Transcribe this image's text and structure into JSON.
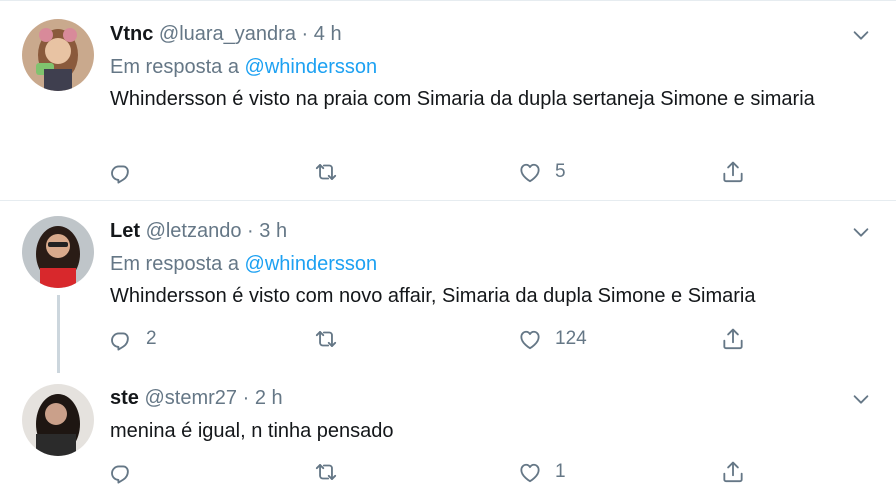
{
  "tweets": [
    {
      "display_name": "Vtnc",
      "handle": "@luara_yandra",
      "time": "4 h",
      "reply_prefix": "Em resposta a",
      "reply_to": "@whindersson",
      "text": "Whindersson é visto na praia com Simaria da dupla sertaneja Simone e simaria",
      "reply_count": "",
      "retweet_count": "",
      "like_count": "5"
    },
    {
      "display_name": "Let",
      "handle": "@letzando",
      "time": "3 h",
      "reply_prefix": "Em resposta a",
      "reply_to": "@whindersson",
      "text": "Whindersson é visto com novo affair, Simaria da dupla Simone e Simaria",
      "reply_count": "2",
      "retweet_count": "",
      "like_count": "124"
    },
    {
      "display_name": "ste",
      "handle": "@stemr27",
      "time": "2 h",
      "text": "menina é igual, n tinha pensado",
      "reply_count": "",
      "retweet_count": "",
      "like_count": "1"
    }
  ],
  "separator": "·",
  "icons": [
    "reply-icon",
    "retweet-icon",
    "like-icon",
    "share-icon",
    "chevron-down-icon"
  ],
  "colors": {
    "link": "#1da1f2",
    "muted": "#657786",
    "text": "#14171a",
    "divider": "#e6ecf0",
    "thread_line": "#ccd6dd"
  }
}
